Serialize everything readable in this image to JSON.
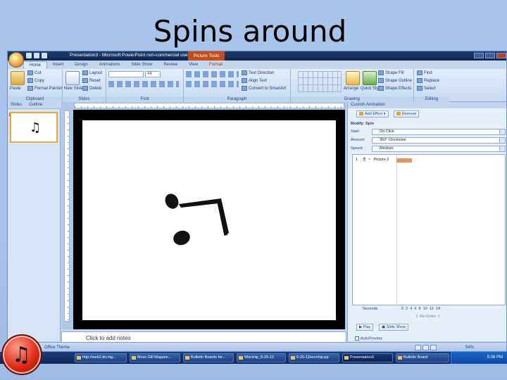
{
  "slide": {
    "title": "Spins around"
  },
  "window": {
    "title": "Presentation3 - Microsoft PowerPoint non-commercial use",
    "context_tab": "Picture Tools"
  },
  "ribbon": {
    "tabs": [
      {
        "label": "Home",
        "active": true
      },
      {
        "label": "Insert"
      },
      {
        "label": "Design"
      },
      {
        "label": "Animations"
      },
      {
        "label": "Slide Show"
      },
      {
        "label": "Review"
      },
      {
        "label": "View"
      },
      {
        "label": "Format",
        "contextual": true
      }
    ],
    "clipboard": {
      "paste": "Paste",
      "cut": "Cut",
      "copy": "Copy",
      "format_painter": "Format Painter",
      "label": "Clipboard"
    },
    "slides": {
      "new_slide": "New Slide",
      "layout": "Layout",
      "reset": "Reset",
      "delete": "Delete",
      "label": "Slides"
    },
    "font": {
      "size": "44",
      "label": "Font"
    },
    "paragraph": {
      "text_direction": "Text Direction",
      "align_text": "Align Text",
      "convert_smartart": "Convert to SmartArt",
      "label": "Paragraph"
    },
    "drawing": {
      "arrange": "Arrange",
      "quick_styles": "Quick Styles",
      "shape_fill": "Shape Fill",
      "shape_outline": "Shape Outline",
      "shape_effects": "Shape Effects",
      "label": "Drawing"
    },
    "editing": {
      "find": "Find",
      "replace": "Replace",
      "select": "Select",
      "label": "Editing"
    }
  },
  "thumbnails": {
    "tab_slides": "Slides",
    "tab_outline": "Outline",
    "slide_number": "1"
  },
  "notes": {
    "placeholder": "Click to add notes"
  },
  "custom_animation": {
    "header": "Custom Animation",
    "add_effect": "Add Effect",
    "remove": "Remove",
    "modify_label": "Modify: Spin",
    "start_label": "Start:",
    "start_value": "On Click",
    "amount_label": "Amount:",
    "amount_value": "360° Clockwise",
    "speed_label": "Speed:",
    "speed_value": "Medium",
    "item_number": "1",
    "item_name": "Picture 2",
    "timeline_label": "Seconds",
    "timeline_ticks": "0  2  4  6  8  10  12  14",
    "reorder": "Re-Order",
    "play": "Play",
    "slide_show": "Slide Show",
    "autopreview": "AutoPreview"
  },
  "statusbar": {
    "slide_info": "Office Theme",
    "zoom": "54%"
  },
  "taskbar": {
    "items": [
      {
        "label": "http://web2.tki.mg..."
      },
      {
        "label": "Moss Gill Magaze..."
      },
      {
        "label": "Bulletin Boards for..."
      },
      {
        "label": "Worship_6-25-12"
      },
      {
        "label": "6-25-12worship.pp"
      },
      {
        "label": "Presentation3",
        "active": true
      },
      {
        "label": "Bulletin Board"
      }
    ],
    "clock": "5:08 PM"
  }
}
